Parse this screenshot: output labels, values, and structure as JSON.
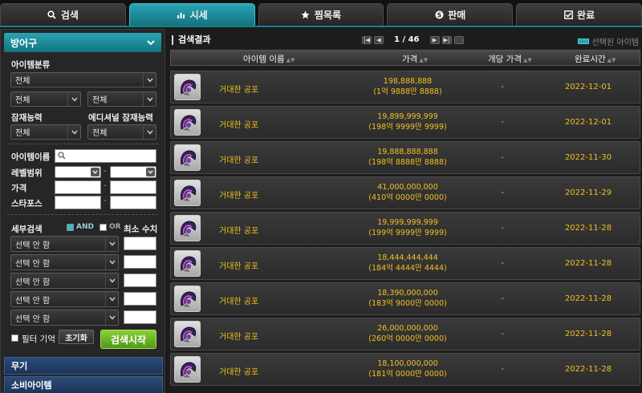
{
  "tabs": [
    {
      "label": "검색",
      "icon": "search-icon",
      "active": false
    },
    {
      "label": "시세",
      "icon": "chart-icon",
      "active": true
    },
    {
      "label": "찜목록",
      "icon": "star-icon",
      "active": false
    },
    {
      "label": "판매",
      "icon": "coin-icon",
      "active": false
    },
    {
      "label": "완료",
      "icon": "check-icon",
      "active": false
    }
  ],
  "sidebar": {
    "header": "방어구",
    "item_class_label": "아이템분류",
    "item_class_value": "전체",
    "sub_class_1": "전체",
    "sub_class_2": "전체",
    "potential_label": "잠재능력",
    "potential_value": "전체",
    "additional_potential_label": "에디셔널 잠재능력",
    "additional_potential_value": "전체",
    "item_name_label": "아이템이름",
    "level_label": "레벨범위",
    "price_label": "가격",
    "starforce_label": "스타포스",
    "detail_search_label": "세부검색",
    "and_label": "AND",
    "or_label": "OR",
    "min_value_label": "최소 수치",
    "option_selects": [
      "선택 안 함",
      "선택 안 함",
      "선택 안 함",
      "선택 안 함",
      "선택 안 함"
    ],
    "filter_memory_label": "필터 기억",
    "reset_label": "초기화",
    "search_button": "검색시작",
    "categories": [
      "무기",
      "소비아이템"
    ]
  },
  "results": {
    "title": "검색결과",
    "page_current": "1",
    "page_total": "46",
    "legend_label": "선택된 아이템",
    "columns": {
      "name": "아이템 이름",
      "price": "가격",
      "unit_price": "개당 가격",
      "completed": "완료시간"
    },
    "rows": [
      {
        "name": "거대한 공포",
        "price": "198,888,888",
        "price_kor": "(1억 9888만 8888)",
        "unit": "-",
        "date": "2022-12-01"
      },
      {
        "name": "거대한 공포",
        "price": "19,899,999,999",
        "price_kor": "(198억 9999만 9999)",
        "unit": "-",
        "date": "2022-12-01"
      },
      {
        "name": "거대한 공포",
        "price": "19,888,888,888",
        "price_kor": "(198억 8888만 8888)",
        "unit": "-",
        "date": "2022-11-30"
      },
      {
        "name": "거대한 공포",
        "price": "41,000,000,000",
        "price_kor": "(410억 0000만 0000)",
        "unit": "-",
        "date": "2022-11-29"
      },
      {
        "name": "거대한 공포",
        "price": "19,999,999,999",
        "price_kor": "(199억 9999만 9999)",
        "unit": "-",
        "date": "2022-11-28"
      },
      {
        "name": "거대한 공포",
        "price": "18,444,444,444",
        "price_kor": "(184억 4444만 4444)",
        "unit": "-",
        "date": "2022-11-28"
      },
      {
        "name": "거대한 공포",
        "price": "18,390,000,000",
        "price_kor": "(183억 9000만 0000)",
        "unit": "-",
        "date": "2022-11-28"
      },
      {
        "name": "거대한 공포",
        "price": "26,000,000,000",
        "price_kor": "(260억 0000만 0000)",
        "unit": "-",
        "date": "2022-11-28"
      },
      {
        "name": "거대한 공포",
        "price": "18,100,000,000",
        "price_kor": "(181억 0000만 0000)",
        "unit": "-",
        "date": "2022-11-28"
      }
    ]
  },
  "colors": {
    "accent": "#1f93a2",
    "price_text": "#f0c020",
    "search_button": "#6ab52a",
    "category_bar": "#233f69"
  }
}
